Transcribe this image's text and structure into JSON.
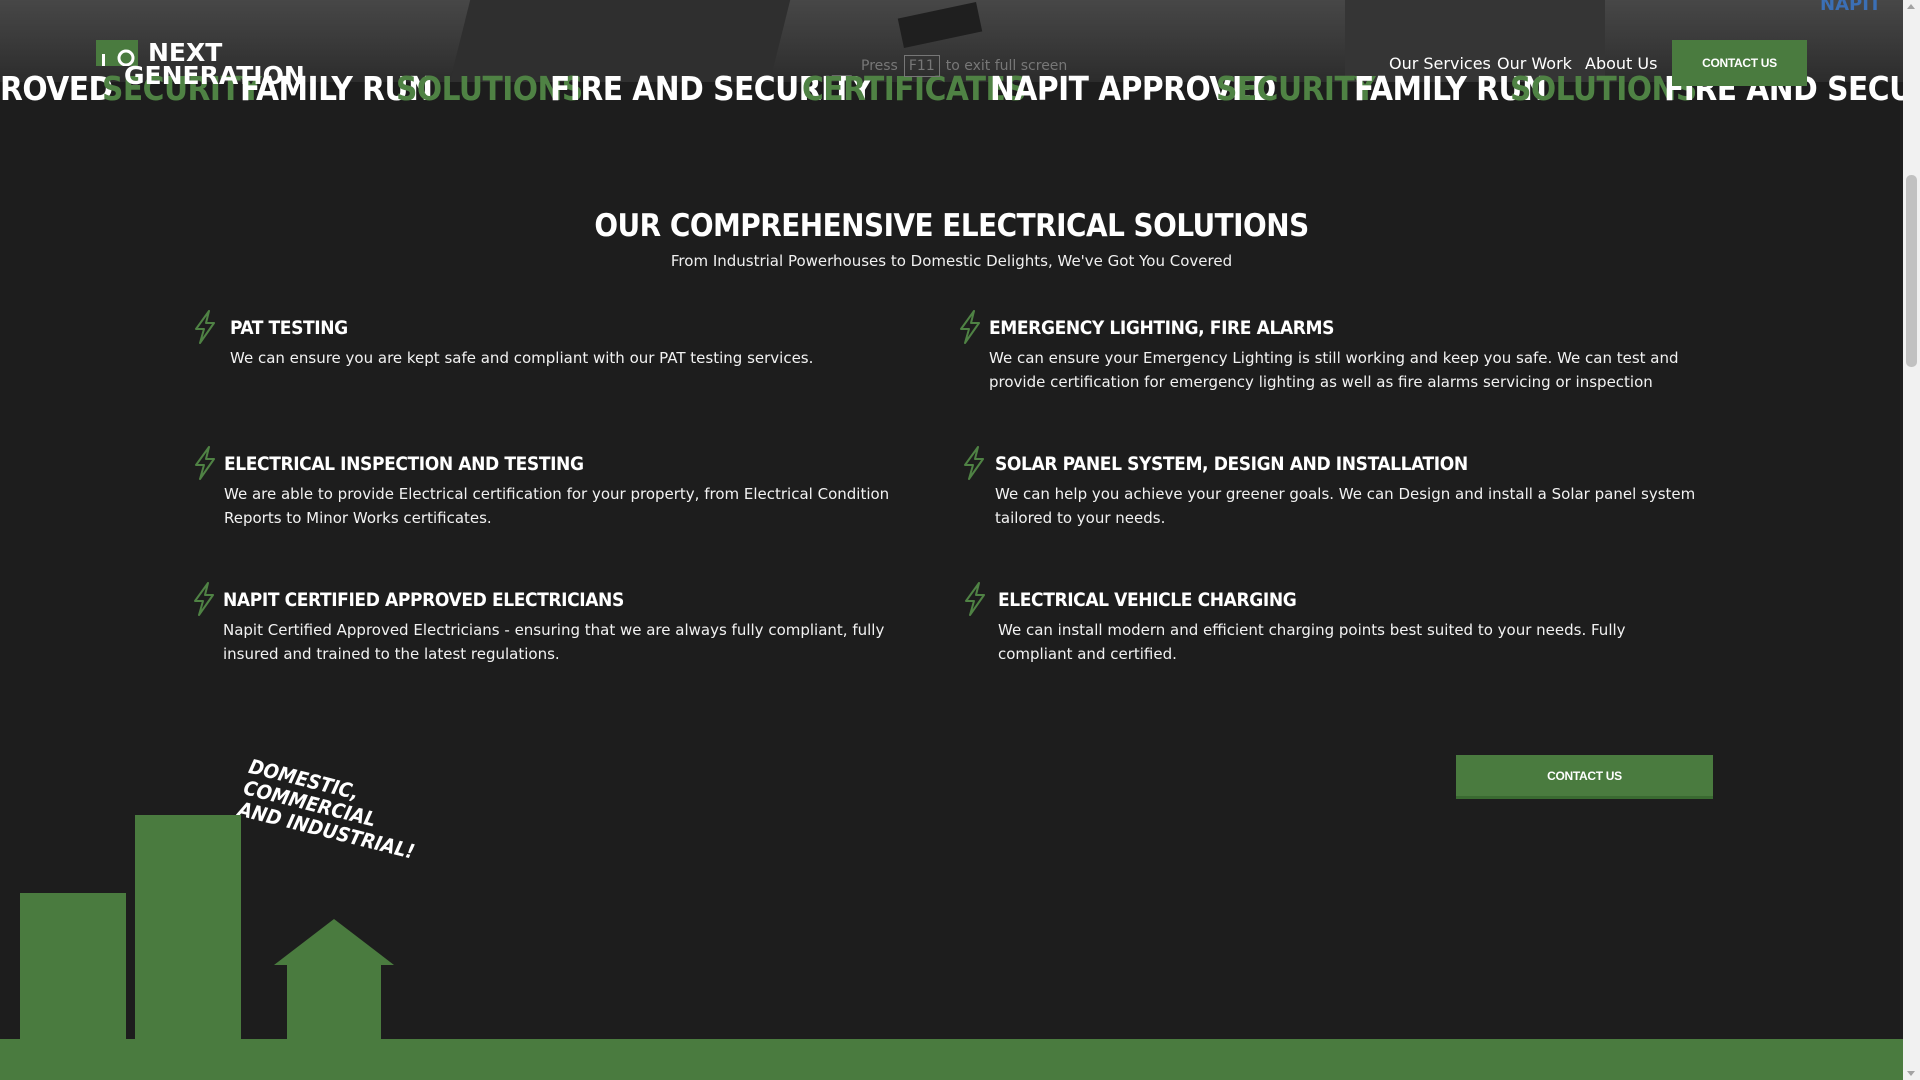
{
  "marquee": [
    {
      "text": "ROVED",
      "color": "white"
    },
    {
      "text": "SECURITY",
      "color": "green"
    },
    {
      "text": "FAMILY RUN",
      "color": "white"
    },
    {
      "text": "SOLUTIONS",
      "color": "green"
    },
    {
      "text": "FIRE AND SECURITY",
      "color": "white"
    },
    {
      "text": "CERTIFICATES",
      "color": "green"
    },
    {
      "text": "NAPIT APPROVED",
      "color": "white"
    },
    {
      "text": "SECURITY",
      "color": "green"
    },
    {
      "text": "FAMILY RUN",
      "color": "white"
    },
    {
      "text": "SOLUTIONS",
      "color": "green"
    },
    {
      "text": "FIRE AND SECURITY",
      "color": "white"
    }
  ],
  "logo": {
    "line1": "NEXT",
    "line2": "GENERATION"
  },
  "fullscreen_hint": {
    "pre": "Press",
    "key": "F11",
    "post": "to exit full screen"
  },
  "nav": {
    "items": [
      "Our Services",
      "Our Work",
      "About Us"
    ],
    "cta": "CONTACT US"
  },
  "napit_badge": "NAPIT",
  "section": {
    "title": "OUR COMPREHENSIVE ELECTRICAL SOLUTIONS",
    "subtitle": "From Industrial Powerhouses to Domestic Delights, We've Got You Covered"
  },
  "services": [
    {
      "title": "PAT TESTING",
      "desc": "We can ensure you are kept safe and compliant with our PAT testing services."
    },
    {
      "title": "EMERGENCY LIGHTING, FIRE ALARMS",
      "desc": "We can ensure your Emergency Lighting is still working and keep you safe. We can test and provide certification for emergency lighting as well as fire alarms servicing or inspection"
    },
    {
      "title": "ELECTRICAL INSPECTION AND TESTING",
      "desc": "We are able to provide Electrical certification for your property, from Electrical Condition Reports to Minor Works certificates."
    },
    {
      "title": "SOLAR PANEL SYSTEM, DESIGN AND INSTALLATION",
      "desc": "We can help you achieve your greener goals. We can Design and install a Solar panel system tailored to your needs."
    },
    {
      "title": "NAPIT CERTIFIED APPROVED ELECTRICIANS",
      "desc": "Napit Certified Approved Electricians - ensuring that we are always fully compliant, fully insured and trained to the latest regulations."
    },
    {
      "title": "ELECTRICAL VEHICLE CHARGING",
      "desc": "We can install modern and efficient charging points best suited to your needs. Fully compliant and certified."
    }
  ],
  "cta2": "CONTACT US",
  "tagline": {
    "line1": "DOMESTIC, COMMERCIAL",
    "line2": "AND INDUSTRIAL!"
  },
  "colors": {
    "brand_green": "#4a7b3f",
    "background": "#1d1d1d",
    "marquee_green": "#4f8244"
  }
}
